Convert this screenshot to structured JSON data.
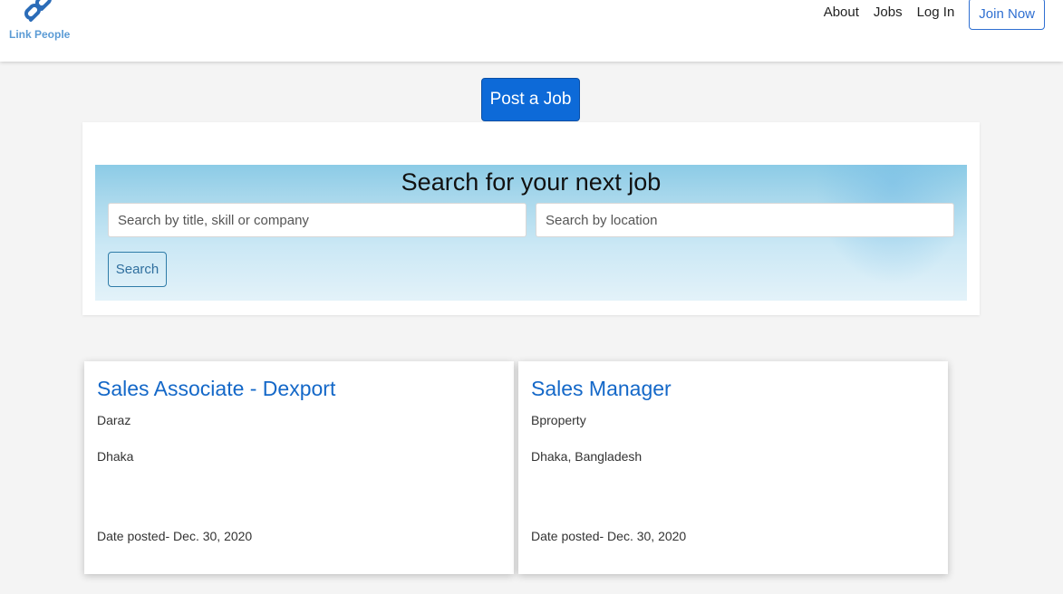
{
  "brand": {
    "name": "Link People",
    "icon": "chain-link-icon",
    "color": "#5b9bd5"
  },
  "nav": {
    "links": [
      "About",
      "Jobs",
      "Log In"
    ],
    "join_label": "Join Now"
  },
  "post_job_label": "Post a Job",
  "search": {
    "title": "Search for your next job",
    "title_placeholder": "Search by title, skill or company",
    "location_placeholder": "Search by location",
    "button_label": "Search"
  },
  "jobs": [
    {
      "title": "Sales Associate - Dexport",
      "company": "Daraz",
      "location": "Dhaka",
      "date": "Date posted- Dec. 30, 2020"
    },
    {
      "title": "Sales Manager",
      "company": "Bproperty",
      "location": "Dhaka, Bangladesh",
      "date": "Date posted- Dec. 30, 2020"
    }
  ],
  "colors": {
    "primary": "#0d6ad8",
    "link": "#1468c8",
    "background": "#f4f4f4"
  }
}
